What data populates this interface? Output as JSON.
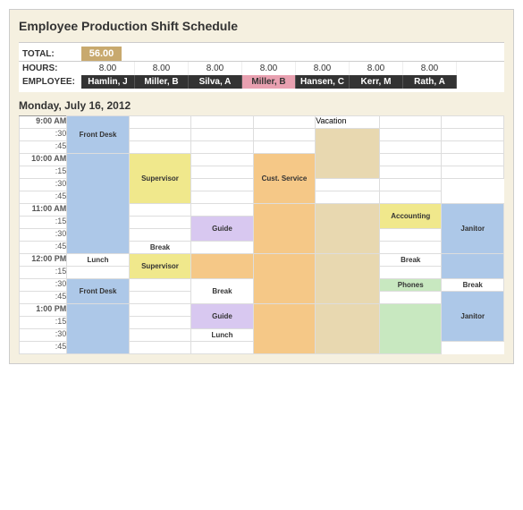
{
  "title": "Employee Production Shift Schedule",
  "totals": {
    "label": "TOTAL:",
    "value": "56.00"
  },
  "hours": {
    "label": "HOURS:",
    "values": [
      "8.00",
      "8.00",
      "8.00",
      "8.00",
      "8.00",
      "8.00",
      "8.00"
    ]
  },
  "employees": {
    "label": "EMPLOYEE:",
    "names": [
      "Hamlin, J",
      "Miller, B",
      "Silva, A",
      "Miller, B",
      "Hansen, C",
      "Kerr, M",
      "Rath, A"
    ],
    "highlight_index": 3
  },
  "day_header": "Monday, July 16, 2012",
  "time_slots": [
    {
      "time": "9:00 AM",
      "major": true
    },
    {
      "time": ":30",
      "major": false
    },
    {
      "time": ":45",
      "major": false
    },
    {
      "time": "10:00 AM",
      "major": true
    },
    {
      "time": ":15",
      "major": false
    },
    {
      "time": ":30",
      "major": false
    },
    {
      "time": ":45",
      "major": false
    },
    {
      "time": "11:00 AM",
      "major": true
    },
    {
      "time": ":15",
      "major": false
    },
    {
      "time": ":30",
      "major": false
    },
    {
      "time": ":45",
      "major": false
    },
    {
      "time": "12:00 PM",
      "major": true
    },
    {
      "time": ":15",
      "major": false
    },
    {
      "time": ":30",
      "major": false
    },
    {
      "time": ":45",
      "major": false
    },
    {
      "time": "1:00 PM",
      "major": true
    },
    {
      "time": ":15",
      "major": false
    },
    {
      "time": ":30",
      "major": false
    },
    {
      "time": ":45",
      "major": false
    }
  ]
}
